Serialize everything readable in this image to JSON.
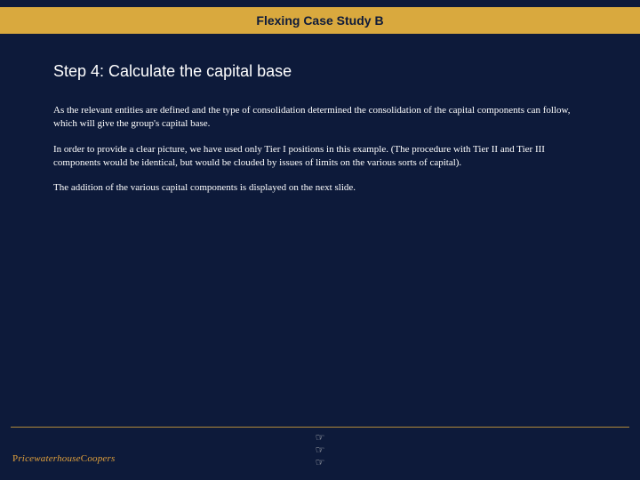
{
  "header": {
    "title": "Flexing Case Study B"
  },
  "main": {
    "heading": "Step 4: Calculate the capital base",
    "paragraphs": [
      "As the relevant entities are defined and the type of consolidation determined the consolidation of the capital components can follow, which will give the group's capital base.",
      "In order to provide a clear picture, we have used only Tier I positions in this example. (The procedure with Tier II and Tier III components would be identical, but would be clouded by issues of limits on the various sorts of capital).",
      "The addition of the various capital components is displayed on the next slide."
    ]
  },
  "footer": {
    "logo_text": "PricewaterhouseCoopers",
    "nav_glyph": "☞"
  }
}
